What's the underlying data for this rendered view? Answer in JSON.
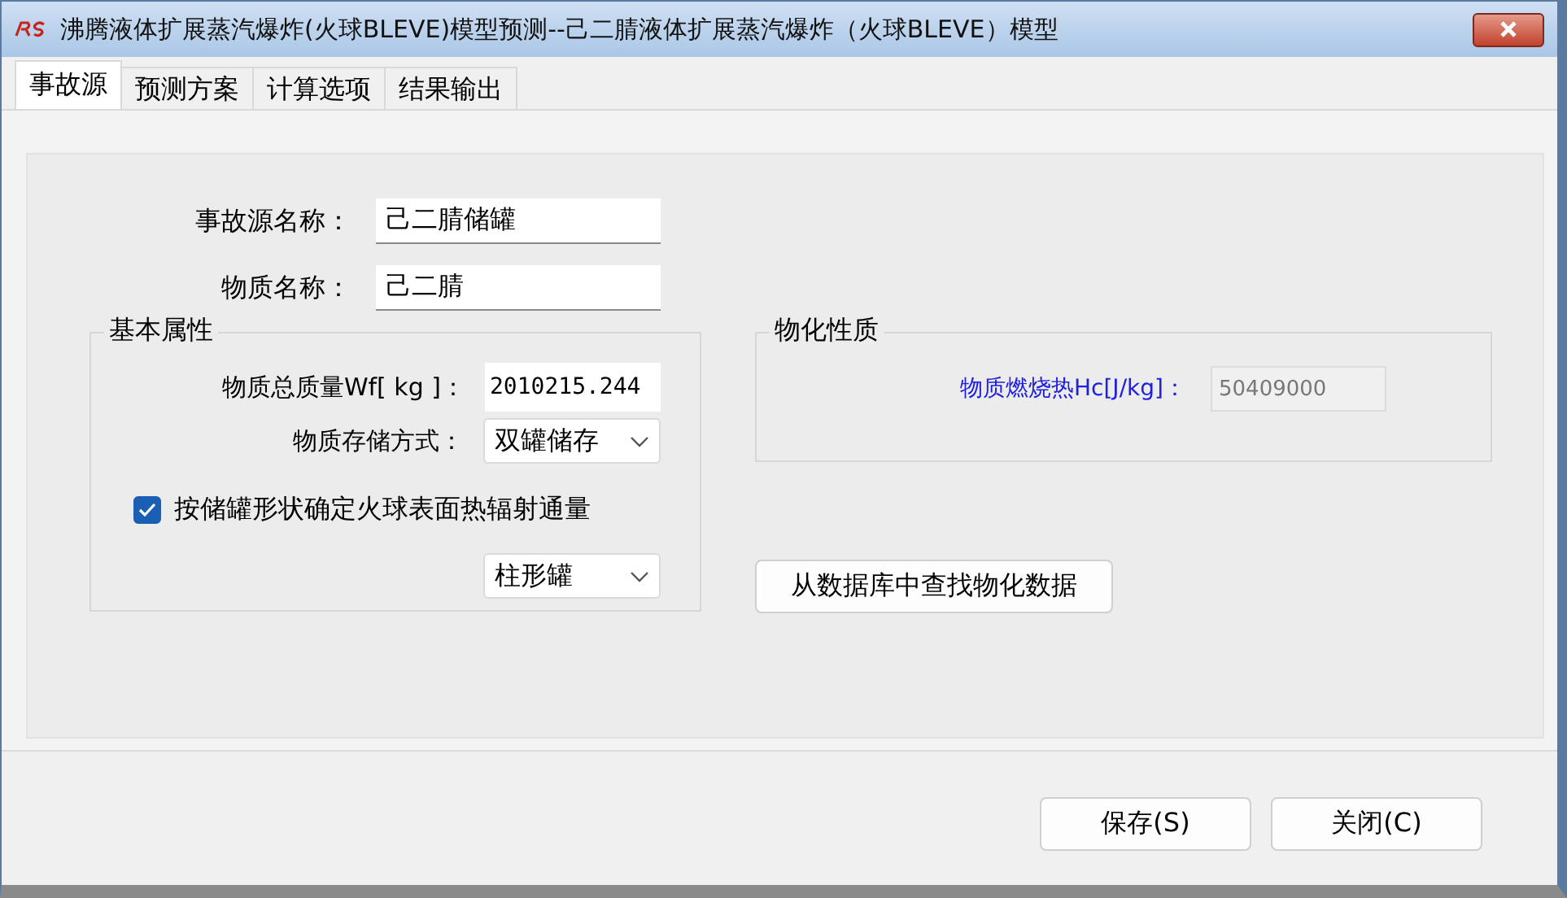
{
  "window": {
    "title": "沸腾液体扩展蒸汽爆炸(火球BLEVE)模型预测--己二腈液体扩展蒸汽爆炸（火球BLEVE）模型"
  },
  "tabs": [
    {
      "label": "事故源",
      "selected": true
    },
    {
      "label": "预测方案",
      "selected": false
    },
    {
      "label": "计算选项",
      "selected": false
    },
    {
      "label": "结果输出",
      "selected": false
    }
  ],
  "fields": [
    {
      "label": "事故源名称：",
      "value": "己二腈储罐"
    },
    {
      "label": "物质名称：",
      "value": "己二腈"
    }
  ],
  "basic_properties": {
    "title": "基本属性",
    "mass": {
      "label": "物质总质量Wf[ kg ]：",
      "value": "2010215.244"
    },
    "storage": {
      "label": "物质存储方式：",
      "value": "双罐储存"
    },
    "shape_checkbox": {
      "label": "按储罐形状确定火球表面热辐射通量",
      "checked": true
    },
    "shape": {
      "value": "柱形罐"
    }
  },
  "physchem": {
    "title": "物化性质",
    "heat": {
      "label": "物质燃烧热Hc[J/kg]：",
      "value": "50409000",
      "disabled": true
    }
  },
  "lookup_button": "从数据库中查找物化数据",
  "buttons": [
    "保存(S)",
    "关闭(C)"
  ]
}
